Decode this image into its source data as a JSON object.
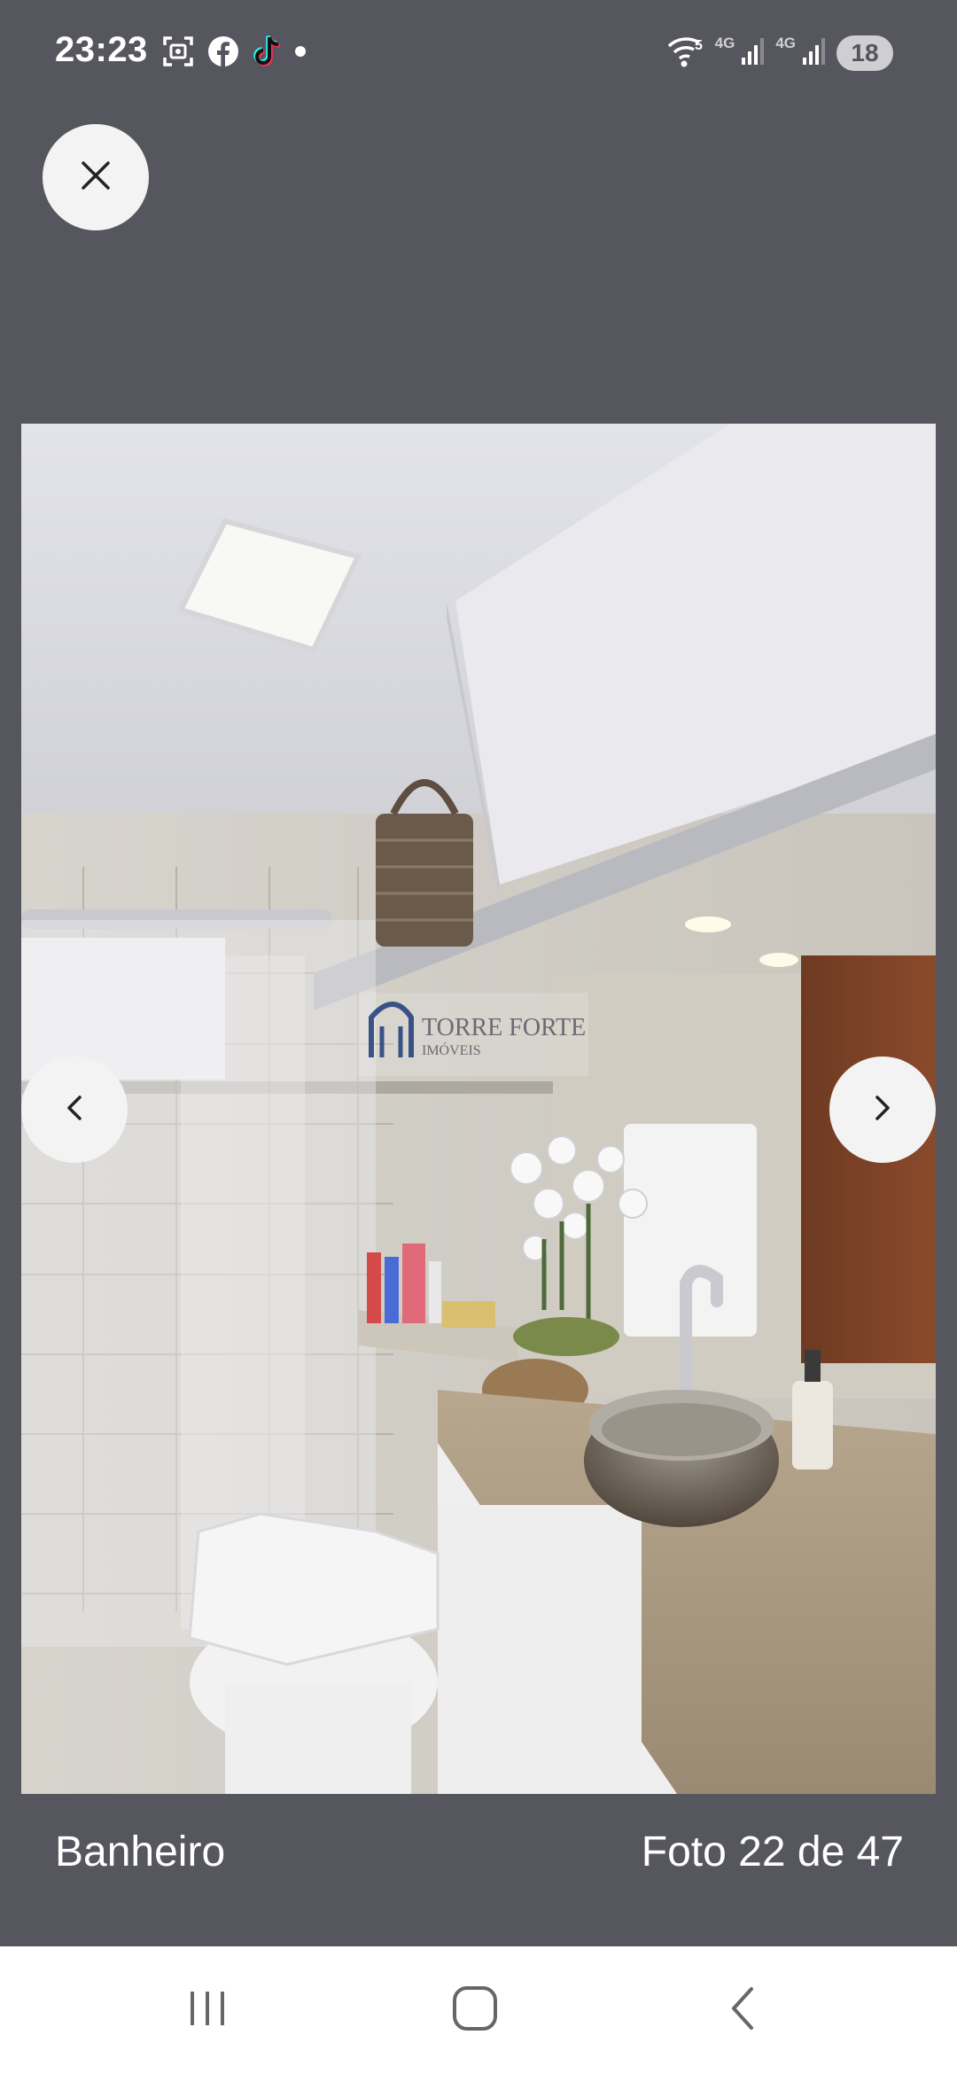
{
  "status_bar": {
    "time": "23:23",
    "notification_icons": [
      "screenshot-icon",
      "facebook-icon",
      "tiktok-icon",
      "dot-icon"
    ],
    "network_labels": [
      "4G",
      "4G"
    ],
    "wifi_label": "5",
    "battery_level": "18"
  },
  "viewer": {
    "close_icon": "close-icon",
    "prev_icon": "chevron-left-icon",
    "next_icon": "chevron-right-icon",
    "watermark": {
      "brand": "TORRE FORTE",
      "sub": "IMÓVEIS"
    }
  },
  "caption": {
    "title": "Banheiro",
    "counter": "Foto 22 de 47"
  },
  "nav_bar": {
    "items": [
      "recent-apps-icon",
      "home-icon",
      "back-icon"
    ]
  },
  "colors": {
    "background": "#56565f",
    "button_bg": "#f3f3f3",
    "nav_bar_bg": "#ffffff"
  }
}
